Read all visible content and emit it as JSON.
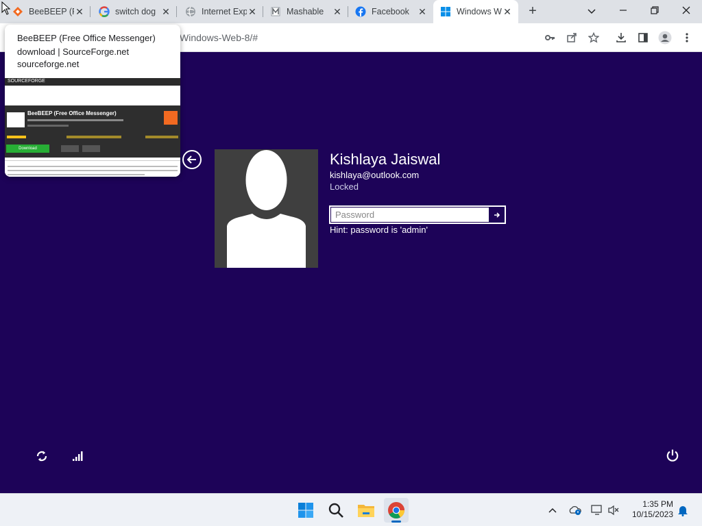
{
  "browser": {
    "tabs": [
      {
        "title": "BeeBEEP (Fr",
        "icon": "sourceforge-icon"
      },
      {
        "title": "switch dog",
        "icon": "google-icon"
      },
      {
        "title": "Internet Exp",
        "icon": "globe-icon"
      },
      {
        "title": "Mashable",
        "icon": "mashable-icon"
      },
      {
        "title": "Facebook",
        "icon": "facebook-icon"
      },
      {
        "title": "Windows W",
        "icon": "windows-icon"
      }
    ],
    "address_text": "Windows-Web-8/#",
    "new_tab": "+"
  },
  "hover_card": {
    "title": "BeeBEEP (Free Office Messenger) download | SourceForge.net",
    "domain": "sourceforge.net",
    "thumb": {
      "brand": "SOURCEFORGE",
      "heading": "BeeBEEP (Free Office Messenger)",
      "download_label": "Download"
    }
  },
  "lockscreen": {
    "name": "Kishlaya Jaiswal",
    "email": "kishlaya@outlook.com",
    "status": "Locked",
    "password_placeholder": "Password",
    "hint": "Hint: password is 'admin'"
  },
  "taskbar": {
    "time": "1:35 PM",
    "date": "10/15/2023"
  },
  "colors": {
    "background": "#1d0358",
    "tabstrip": "#dee1e6",
    "avatar_bg": "#3f3f3f",
    "taskbar": "#eef1f6"
  }
}
